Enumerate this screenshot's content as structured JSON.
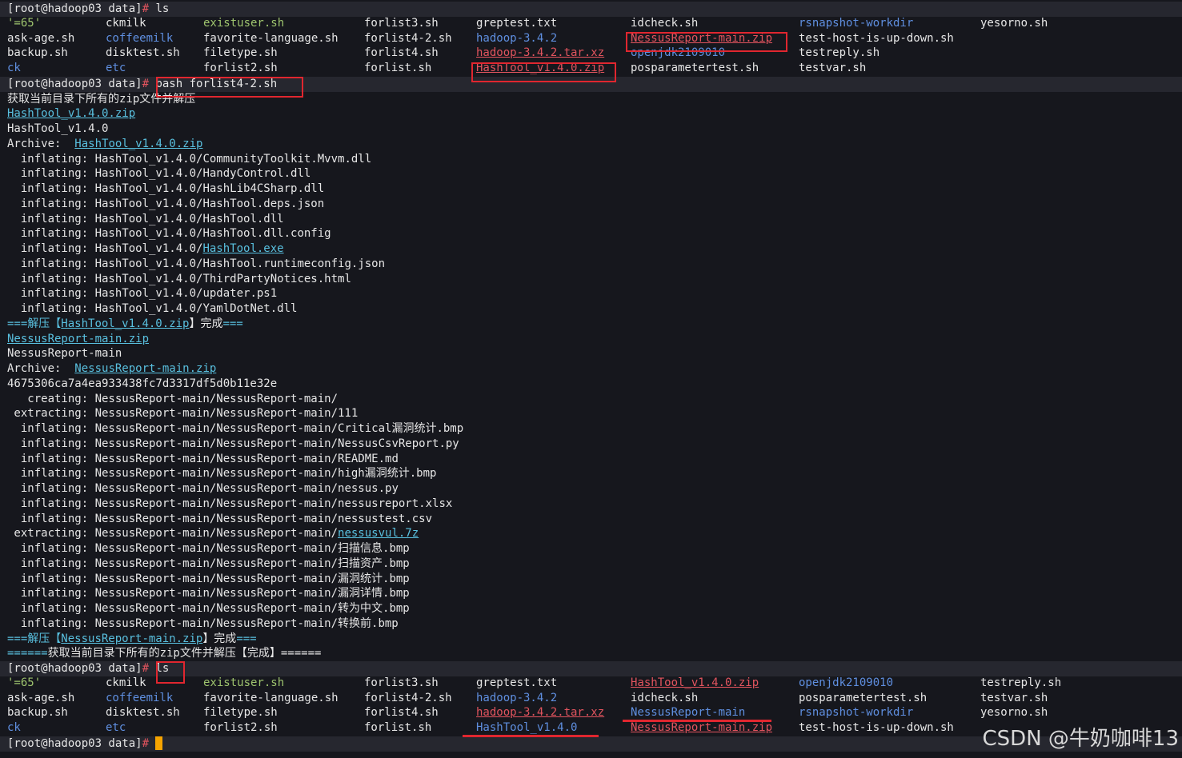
{
  "prompt": "[root@hadoop03 data]",
  "hash": "# ",
  "cmd1": "ls",
  "cmd2": "bash forlist4-2.sh",
  "cmd3": "ls",
  "ls1": {
    "rows": [
      [
        {
          "t": "'=65'",
          "c": "green"
        },
        {
          "t": "ckmilk",
          "c": "white"
        },
        {
          "t": "existuser.sh",
          "c": "green"
        },
        {
          "t": "forlist3.sh",
          "c": "white"
        },
        {
          "t": "greptest.txt",
          "c": "white"
        },
        {
          "t": "idcheck.sh",
          "c": "white"
        },
        {
          "t": "rsnapshot-workdir",
          "c": "blue"
        },
        {
          "t": "yesorno.sh",
          "c": "white"
        }
      ],
      [
        {
          "t": "ask-age.sh",
          "c": "white"
        },
        {
          "t": "coffeemilk",
          "c": "blue"
        },
        {
          "t": "favorite-language.sh",
          "c": "white"
        },
        {
          "t": "forlist4-2.sh",
          "c": "white"
        },
        {
          "t": "hadoop-3.4.2",
          "c": "blue"
        },
        {
          "t": "NessusReport-main.zip",
          "c": "red"
        },
        {
          "t": "test-host-is-up-down.sh",
          "c": "white"
        },
        {
          "t": "",
          "c": "white"
        }
      ],
      [
        {
          "t": "backup.sh",
          "c": "white"
        },
        {
          "t": "disktest.sh",
          "c": "white"
        },
        {
          "t": "filetype.sh",
          "c": "white"
        },
        {
          "t": "forlist4.sh",
          "c": "white"
        },
        {
          "t": "hadoop-3.4.2.tar.xz",
          "c": "red"
        },
        {
          "t": "openjdk2109010",
          "c": "blue"
        },
        {
          "t": "testreply.sh",
          "c": "white"
        },
        {
          "t": "",
          "c": "white"
        }
      ],
      [
        {
          "t": "ck",
          "c": "blue"
        },
        {
          "t": "etc",
          "c": "blue"
        },
        {
          "t": "forlist2.sh",
          "c": "white"
        },
        {
          "t": "forlist.sh",
          "c": "white"
        },
        {
          "t": "HashTool_v1.4.0.zip",
          "c": "red"
        },
        {
          "t": "posparametertest.sh",
          "c": "white"
        },
        {
          "t": "testvar.sh",
          "c": "white"
        },
        {
          "t": "",
          "c": "white"
        }
      ]
    ]
  },
  "out": {
    "l1": "获取当前目录下所有的zip文件并解压",
    "zip1": "HashTool_v1.4.0.zip",
    "dir1": "HashTool_v1.4.0",
    "archive_label": "Archive:  ",
    "inflate_prefix": "  inflating: ",
    "inflate1": [
      "HashTool_v1.4.0/CommunityToolkit.Mvvm.dll",
      "HashTool_v1.4.0/HandyControl.dll",
      "HashTool_v1.4.0/HashLib4CSharp.dll",
      "HashTool_v1.4.0/HashTool.deps.json",
      "HashTool_v1.4.0/HashTool.dll",
      "HashTool_v1.4.0/HashTool.dll.config"
    ],
    "inflate_exe_prefix": "HashTool_v1.4.0/",
    "inflate_exe": "HashTool.exe",
    "inflate1b": [
      "HashTool_v1.4.0/HashTool.runtimeconfig.json",
      "HashTool_v1.4.0/ThirdPartyNotices.html",
      "HashTool_v1.4.0/updater.ps1",
      "HashTool_v1.4.0/YamlDotNet.dll"
    ],
    "eq": "===",
    "done_pre": "解压【",
    "done_post": "】完成",
    "zip2": "NessusReport-main.zip",
    "dir2": "NessusReport-main",
    "hashline": "4675306ca7a4ea933438fc7d3317df5d0b11e32e",
    "creating": "   creating: NessusReport-main/NessusReport-main/",
    "extracting1": " extracting: NessusReport-main/NessusReport-main/111",
    "inflate2": [
      "NessusReport-main/NessusReport-main/Critical漏洞统计.bmp",
      "NessusReport-main/NessusReport-main/NessusCsvReport.py",
      "NessusReport-main/NessusReport-main/README.md",
      "NessusReport-main/NessusReport-main/high漏洞统计.bmp",
      "NessusReport-main/NessusReport-main/nessus.py",
      "NessusReport-main/NessusReport-main/nessusreport.xlsx",
      "NessusReport-main/NessusReport-main/nessustest.csv"
    ],
    "extracting2_prefix": " extracting: NessusReport-main/NessusReport-main/",
    "extracting2_link": "nessusvul.7z",
    "inflate3": [
      "NessusReport-main/NessusReport-main/扫描信息.bmp",
      "NessusReport-main/NessusReport-main/扫描资产.bmp",
      "NessusReport-main/NessusReport-main/漏洞统计.bmp",
      "NessusReport-main/NessusReport-main/漏洞详情.bmp",
      "NessusReport-main/NessusReport-main/转为中文.bmp",
      "NessusReport-main/NessusReport-main/转换前.bmp"
    ],
    "final_eq": "======",
    "final_text": "获取当前目录下所有的zip文件并解压【完成】======"
  },
  "ls2": {
    "rows": [
      [
        {
          "t": "'=65'",
          "c": "green"
        },
        {
          "t": "ckmilk",
          "c": "white"
        },
        {
          "t": "existuser.sh",
          "c": "green"
        },
        {
          "t": "forlist3.sh",
          "c": "white"
        },
        {
          "t": "greptest.txt",
          "c": "white"
        },
        {
          "t": "HashTool_v1.4.0.zip",
          "c": "red"
        },
        {
          "t": "openjdk2109010",
          "c": "blue"
        },
        {
          "t": "testreply.sh",
          "c": "white"
        }
      ],
      [
        {
          "t": "ask-age.sh",
          "c": "white"
        },
        {
          "t": "coffeemilk",
          "c": "blue"
        },
        {
          "t": "favorite-language.sh",
          "c": "white"
        },
        {
          "t": "forlist4-2.sh",
          "c": "white"
        },
        {
          "t": "hadoop-3.4.2",
          "c": "blue"
        },
        {
          "t": "idcheck.sh",
          "c": "white"
        },
        {
          "t": "posparametertest.sh",
          "c": "white"
        },
        {
          "t": "testvar.sh",
          "c": "white"
        }
      ],
      [
        {
          "t": "backup.sh",
          "c": "white"
        },
        {
          "t": "disktest.sh",
          "c": "white"
        },
        {
          "t": "filetype.sh",
          "c": "white"
        },
        {
          "t": "forlist4.sh",
          "c": "white"
        },
        {
          "t": "hadoop-3.4.2.tar.xz",
          "c": "red"
        },
        {
          "t": "NessusReport-main",
          "c": "blue"
        },
        {
          "t": "rsnapshot-workdir",
          "c": "blue"
        },
        {
          "t": "yesorno.sh",
          "c": "white"
        }
      ],
      [
        {
          "t": "ck",
          "c": "blue"
        },
        {
          "t": "etc",
          "c": "blue"
        },
        {
          "t": "forlist2.sh",
          "c": "white"
        },
        {
          "t": "forlist.sh",
          "c": "white"
        },
        {
          "t": "HashTool_v1.4.0",
          "c": "blue"
        },
        {
          "t": "NessusReport-main.zip",
          "c": "red"
        },
        {
          "t": "test-host-is-up-down.sh",
          "c": "white"
        },
        {
          "t": "",
          "c": "white"
        }
      ]
    ]
  },
  "watermark": "CSDN @牛奶咖啡13"
}
